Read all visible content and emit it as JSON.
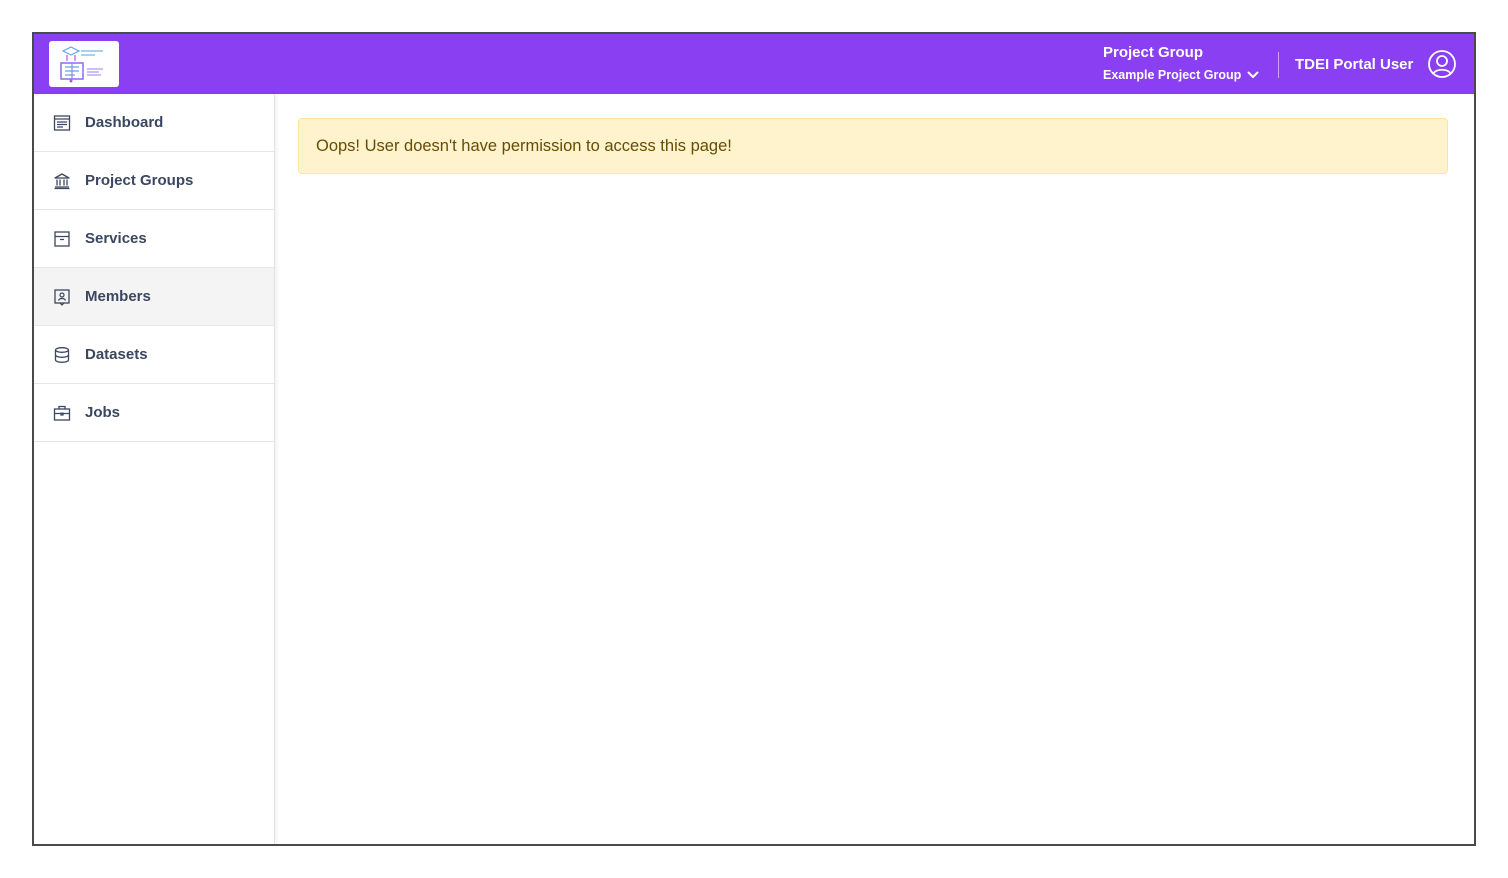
{
  "header": {
    "logo_icon": "tdei-logo-icon",
    "project_group_title": "Project Group",
    "project_group_value": "Example Project Group",
    "user_name": "TDEI Portal User",
    "brand_color": "#8a3ff2"
  },
  "sidebar": {
    "items": [
      {
        "label": "Dashboard",
        "icon": "dashboard-icon",
        "active": false
      },
      {
        "label": "Project Groups",
        "icon": "bank-icon",
        "active": false
      },
      {
        "label": "Services",
        "icon": "archive-icon",
        "active": false
      },
      {
        "label": "Members",
        "icon": "members-icon",
        "active": true
      },
      {
        "label": "Datasets",
        "icon": "database-icon",
        "active": false
      },
      {
        "label": "Jobs",
        "icon": "briefcase-icon",
        "active": false
      }
    ]
  },
  "main": {
    "alert_message": "Oops! User doesn't have permission to access this page!",
    "alert_bg": "#fff3cd"
  }
}
